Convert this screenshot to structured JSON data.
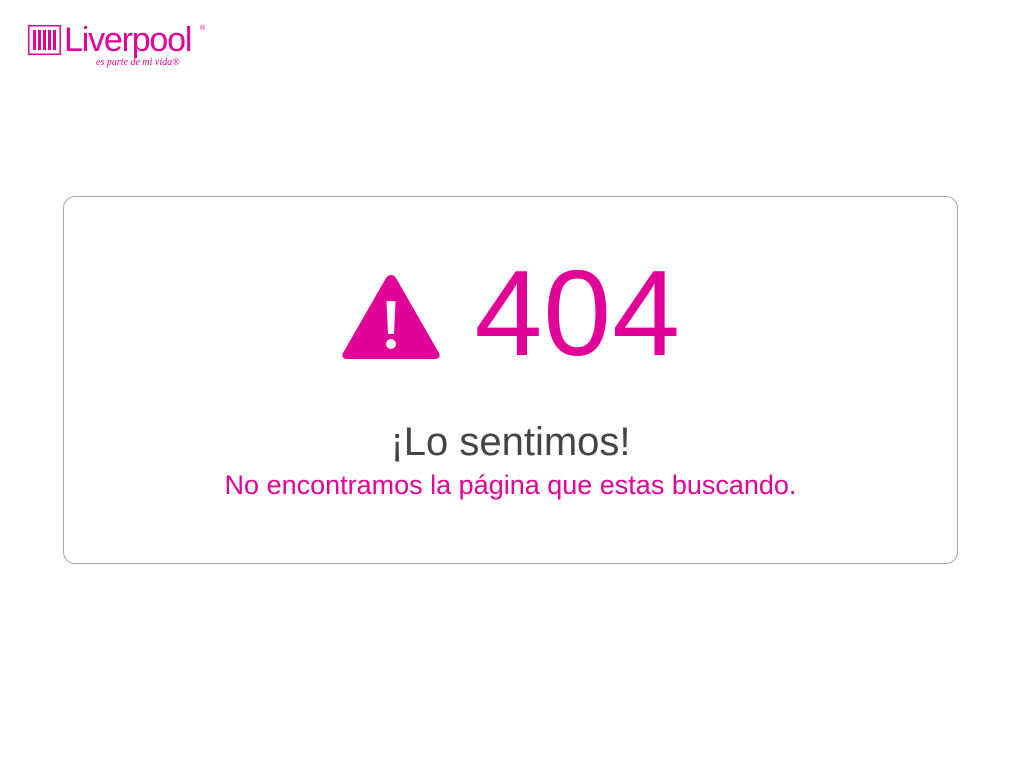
{
  "brand": {
    "name": "Liverpool",
    "registered": "®",
    "tagline": "es parte de mi vida®",
    "color": "#e10098"
  },
  "error_page": {
    "icon": "warning-triangle-icon",
    "code": "404",
    "title": "¡Lo sentimos!",
    "message": "No encontramos la página que estas buscando.",
    "accent_color": "#e10098",
    "title_color": "#444444",
    "border_color": "#a8a8a8"
  }
}
